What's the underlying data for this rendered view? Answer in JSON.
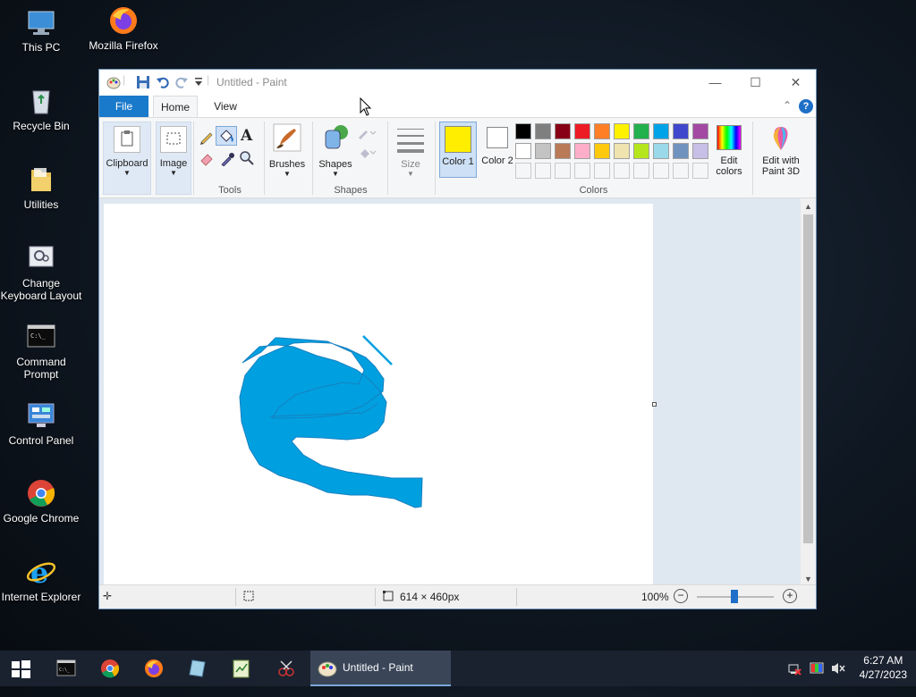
{
  "desktop": {
    "icons": [
      {
        "label": "This PC"
      },
      {
        "label": "Mozilla Firefox"
      },
      {
        "label": "Recycle Bin"
      },
      {
        "label": "Utilities"
      },
      {
        "label": "Change Keyboard Layout"
      },
      {
        "label": "Command Prompt"
      },
      {
        "label": "Control Panel"
      },
      {
        "label": "Google Chrome"
      },
      {
        "label": "Internet Explorer"
      }
    ]
  },
  "window": {
    "title": "Untitled - Paint",
    "tabs": [
      "File",
      "Home",
      "View"
    ],
    "groups": {
      "clipboard": "Clipboard",
      "image": "Image",
      "tools": "Tools",
      "brushes": "Brushes",
      "shapes_btn": "Shapes",
      "shapes_group": "Shapes",
      "size": "Size",
      "color1": "Color 1",
      "color2": "Color 2",
      "colors": "Colors",
      "edit_colors": "Edit colors",
      "paint3d": "Edit with Paint 3D"
    },
    "color1_value": "#ffee00",
    "color2_value": "#ffffff",
    "palette_row1": [
      "#000000",
      "#7f7f7f",
      "#880015",
      "#ed1c24",
      "#ff7f27",
      "#fff200",
      "#22b14c",
      "#00a2e8",
      "#3f48cc",
      "#a349a4"
    ],
    "palette_row2": [
      "#ffffff",
      "#c3c3c3",
      "#b97a57",
      "#ffaec9",
      "#ffc90e",
      "#efe4b0",
      "#b5e61d",
      "#99d9ea",
      "#7092be",
      "#c8bfe7"
    ],
    "status": {
      "dimensions": "614 × 460px",
      "zoom": "100%"
    },
    "drawing_color": "#00a0e0"
  },
  "taskbar": {
    "active_app": "Untitled - Paint",
    "time": "6:27 AM",
    "date": "4/27/2023"
  }
}
